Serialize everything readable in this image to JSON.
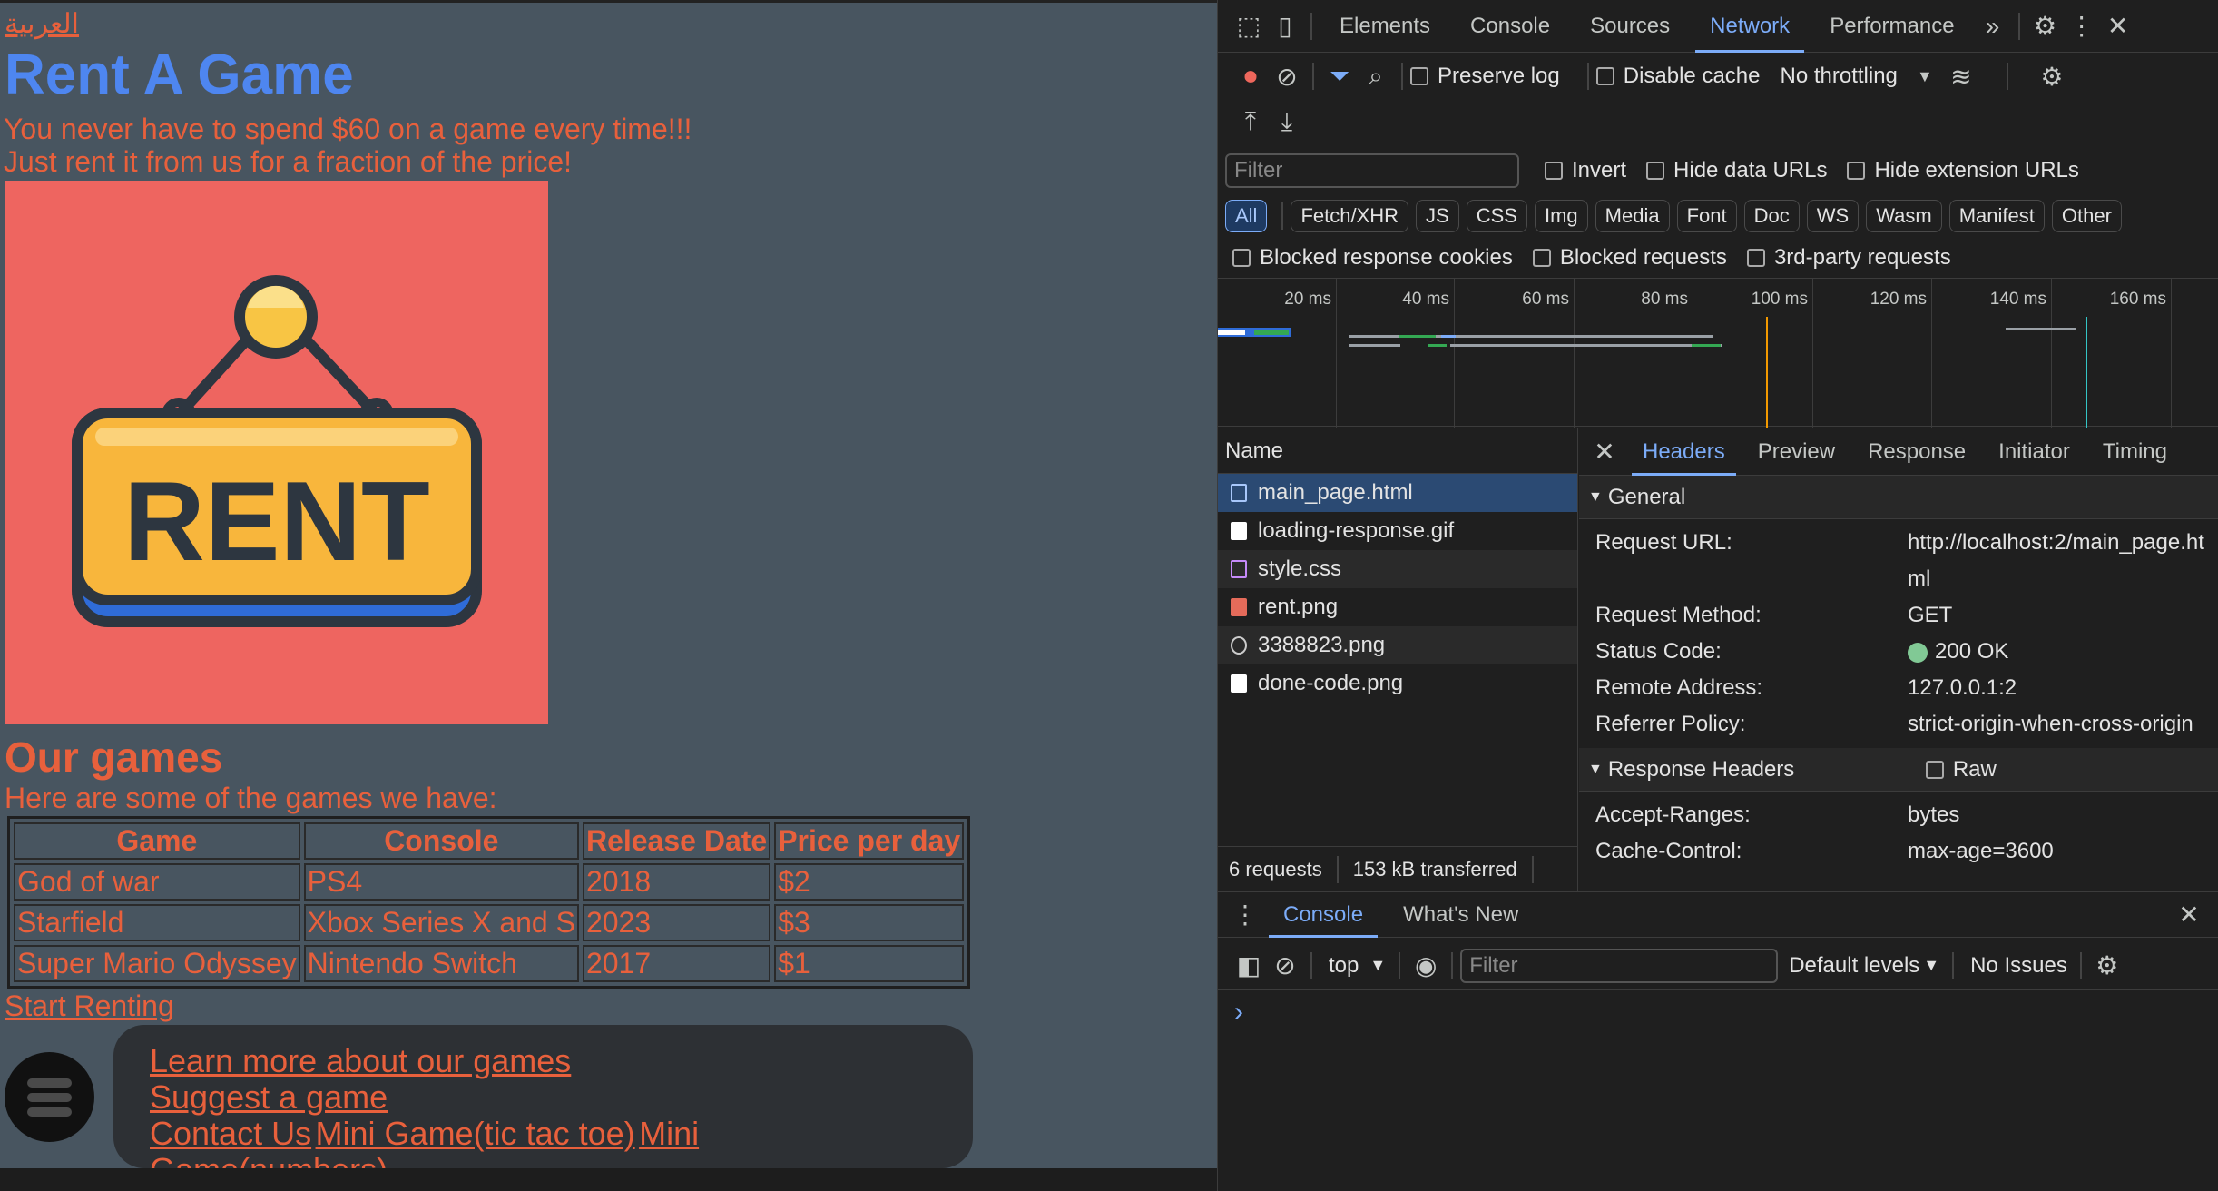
{
  "page": {
    "lang_link": "العربية",
    "title": "Rent A Game",
    "tagline_1": "You never have to spend $60 on a game every time!!!",
    "tagline_2": "Just rent it from us for a fraction of the price!",
    "rent_sign_text": "RENT",
    "games_heading": "Our games",
    "games_intro": "Here are some of the games we have:",
    "table": {
      "headers": [
        "Game",
        "Console",
        "Release Date",
        "Price per day"
      ],
      "rows": [
        [
          "God of war",
          "PS4",
          "2018",
          "$2"
        ],
        [
          "Starfield",
          "Xbox Series X and S",
          "2023",
          "$3"
        ],
        [
          "Super Mario Odyssey",
          "Nintendo Switch",
          "2017",
          "$1"
        ]
      ]
    },
    "start_link": "Start Renting",
    "nav": {
      "learn": "Learn more about our games",
      "suggest": "Suggest a game",
      "contact": "Contact Us",
      "tictactoe": "Mini Game(tic tac toe)",
      "numbers": "Mini Game(numbers)"
    }
  },
  "devtools": {
    "tabs": [
      "Elements",
      "Console",
      "Sources",
      "Network",
      "Performance"
    ],
    "active_tab": "Network",
    "toolbar": {
      "preserve_log": "Preserve log",
      "disable_cache": "Disable cache",
      "throttling": "No throttling"
    },
    "filter": {
      "placeholder": "Filter",
      "invert": "Invert",
      "hide_data_urls": "Hide data URLs",
      "hide_extension_urls": "Hide extension URLs",
      "types": [
        "All",
        "Fetch/XHR",
        "JS",
        "CSS",
        "Img",
        "Media",
        "Font",
        "Doc",
        "WS",
        "Wasm",
        "Manifest",
        "Other"
      ],
      "blocked_cookies": "Blocked response cookies",
      "blocked_requests": "Blocked requests",
      "third_party": "3rd-party requests"
    },
    "timeline_ticks": [
      "20 ms",
      "40 ms",
      "60 ms",
      "80 ms",
      "100 ms",
      "120 ms",
      "140 ms",
      "160 ms"
    ],
    "requests": {
      "column": "Name",
      "files": [
        "main_page.html",
        "loading-response.gif",
        "style.css",
        "rent.png",
        "3388823.png",
        "done-code.png"
      ],
      "summary_count": "6 requests",
      "summary_transferred": "153 kB transferred"
    },
    "details": {
      "tabs": [
        "Headers",
        "Preview",
        "Response",
        "Initiator",
        "Timing"
      ],
      "general_label": "General",
      "general": [
        {
          "k": "Request URL:",
          "v": "http://localhost:2/main_page.html"
        },
        {
          "k": "Request Method:",
          "v": "GET"
        },
        {
          "k": "Status Code:",
          "v": "200 OK"
        },
        {
          "k": "Remote Address:",
          "v": "127.0.0.1:2"
        },
        {
          "k": "Referrer Policy:",
          "v": "strict-origin-when-cross-origin"
        }
      ],
      "response_headers_label": "Response Headers",
      "raw_label": "Raw",
      "response_headers": [
        {
          "k": "Accept-Ranges:",
          "v": "bytes"
        },
        {
          "k": "Cache-Control:",
          "v": "max-age=3600"
        }
      ]
    },
    "drawer": {
      "tabs": [
        "Console",
        "What's New"
      ],
      "context": "top",
      "filter_placeholder": "Filter",
      "levels": "Default levels",
      "issues": "No Issues",
      "prompt": "›"
    }
  },
  "colors": {
    "accent_blue": "#7cacf8",
    "page_bg": "#485560",
    "brand_orange": "#e8603c",
    "title_blue": "#4e86f0",
    "status_green": "#81c995"
  }
}
